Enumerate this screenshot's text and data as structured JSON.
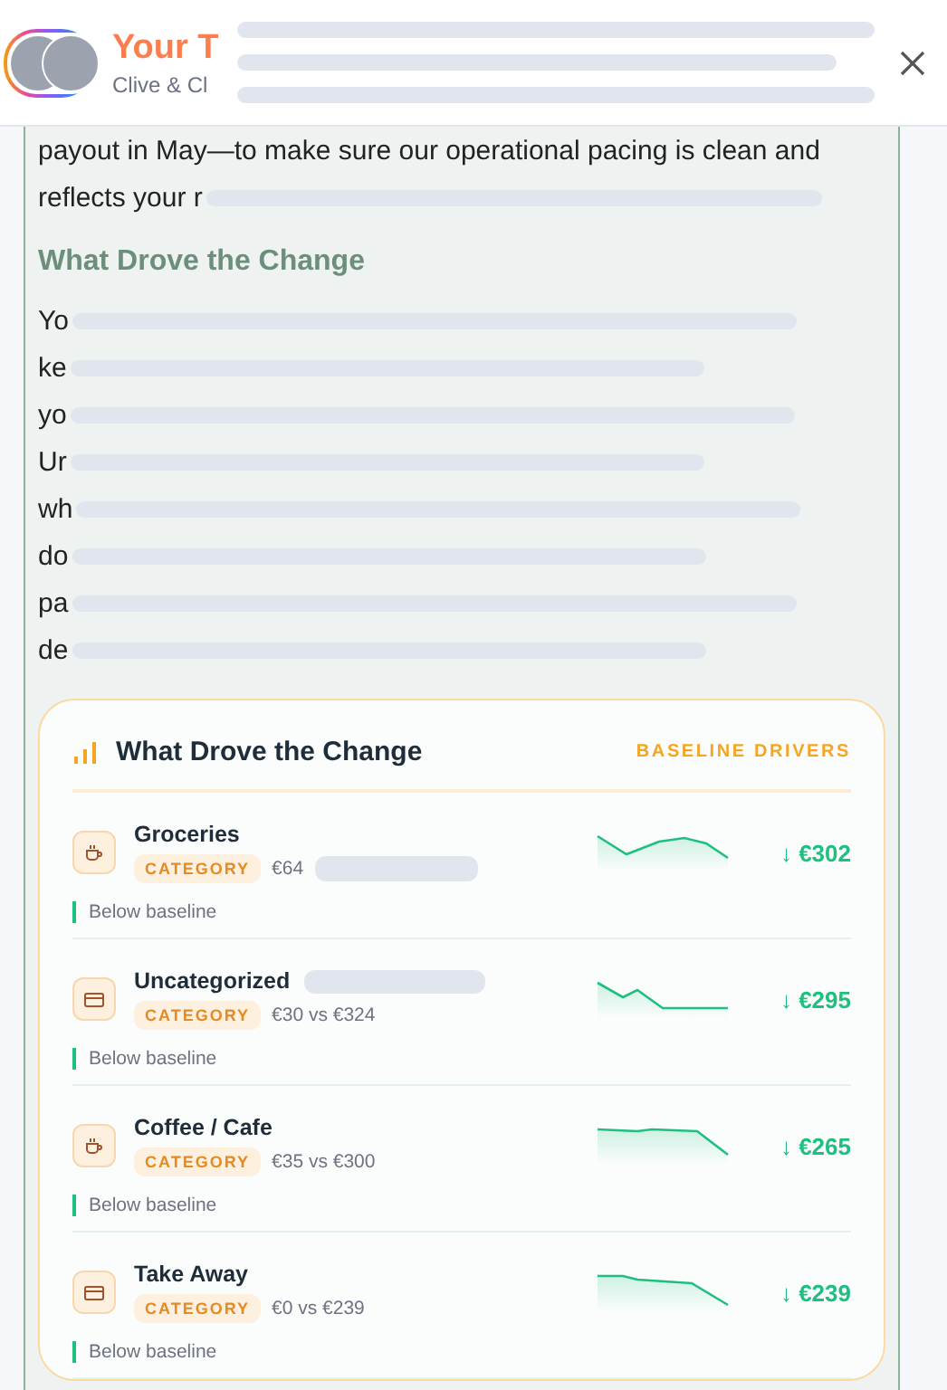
{
  "header": {
    "title": "Your T",
    "subtitle": "Clive & Cl",
    "redacted": true
  },
  "intro_lines": [
    {
      "text": "payout in May—to make sure our operational pacing is clean and",
      "redacted": false
    },
    {
      "text": "reflects your r",
      "redacted": true
    }
  ],
  "section_heading": "What Drove the Change",
  "body_lines": [
    {
      "text": "Yo",
      "redacted": true
    },
    {
      "text": "ke",
      "redacted": true
    },
    {
      "text": "yo",
      "redacted": true
    },
    {
      "text": "Ur",
      "redacted": true
    },
    {
      "text": "wh",
      "redacted": true
    },
    {
      "text": "do",
      "redacted": true
    },
    {
      "text": "pa",
      "redacted": true
    },
    {
      "text": "de",
      "redacted": true
    }
  ],
  "drivers_card": {
    "title": "What Drove the Change",
    "tag": "BASELINE DRIVERS",
    "rows": [
      {
        "kind": "cup",
        "name": "Groceries",
        "name_redacted": false,
        "badge": "CATEGORY",
        "compare": "€64",
        "compare_redacted": true,
        "delta": "↓ €302",
        "note": "Below baseline"
      },
      {
        "kind": "card",
        "name": "Uncategorized",
        "name_redacted": true,
        "badge": "CATEGORY",
        "compare": "€30 vs €324",
        "compare_redacted": false,
        "delta": "↓ €295",
        "note": "Below baseline"
      },
      {
        "kind": "cup",
        "name": "Coffee / Cafe",
        "name_redacted": false,
        "badge": "CATEGORY",
        "compare": "€35 vs €300",
        "compare_redacted": false,
        "delta": "↓ €265",
        "note": "Below baseline"
      },
      {
        "kind": "card",
        "name": "Take Away",
        "name_redacted": false,
        "badge": "CATEGORY",
        "compare": "€0 vs €239",
        "compare_redacted": false,
        "delta": "↓ €239",
        "note": "Below baseline"
      }
    ]
  }
}
